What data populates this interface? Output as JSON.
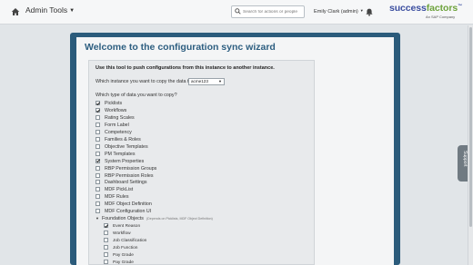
{
  "header": {
    "admin_tools_label": "Admin Tools",
    "search_placeholder": "Search for actions or people",
    "user_name": "Emily Clark (admin)",
    "logo_main_left": "success",
    "logo_main_right": "factors",
    "logo_tm": "™",
    "logo_sub": "An SAP Company"
  },
  "wizard": {
    "title": "Welcome to the configuration sync wizard",
    "intro": "Use this tool to push configurations from this instance to another instance.",
    "which_instance_label": "Which instance you want to copy the data to:",
    "target_instance": "acme123",
    "data_question": "Which type of data you want to copy?",
    "options": [
      {
        "label": "Picklists",
        "checked": true
      },
      {
        "label": "Workflows",
        "checked": true
      },
      {
        "label": "Rating Scales",
        "checked": false
      },
      {
        "label": "Form Label",
        "checked": false
      },
      {
        "label": "Competency",
        "checked": false
      },
      {
        "label": "Families & Roles",
        "checked": false
      },
      {
        "label": "Objective Templates",
        "checked": false
      },
      {
        "label": "PM Templates",
        "checked": false
      },
      {
        "label": "System Properties",
        "checked": true
      },
      {
        "label": "RBP Permission Groups",
        "checked": false
      },
      {
        "label": "RBP Permission Roles",
        "checked": false
      },
      {
        "label": "Dashboard Settings",
        "checked": false
      },
      {
        "label": "MDF PickList",
        "checked": false
      },
      {
        "label": "MDF Rules",
        "checked": false
      },
      {
        "label": "MDF Object Definition",
        "checked": false
      },
      {
        "label": "MDF Configuration UI",
        "checked": false
      }
    ],
    "foundation_objects": {
      "label": "Foundation Objects",
      "hint": "(Depends on Picklists, MDF Object Definition)",
      "children": [
        {
          "label": "Event Reason",
          "checked": true
        },
        {
          "label": "Workflow",
          "checked": false
        },
        {
          "label": "Job Classification",
          "checked": false
        },
        {
          "label": "Job Function",
          "checked": false
        },
        {
          "label": "Pay Grade",
          "checked": false
        },
        {
          "label": "Pay Grade",
          "checked": false
        }
      ]
    }
  },
  "support_label": "Support",
  "colors": {
    "frame": "#2b5b7b",
    "title": "#2d5e80",
    "logo_blue": "#3c4fa0",
    "logo_green": "#6ea33d"
  }
}
